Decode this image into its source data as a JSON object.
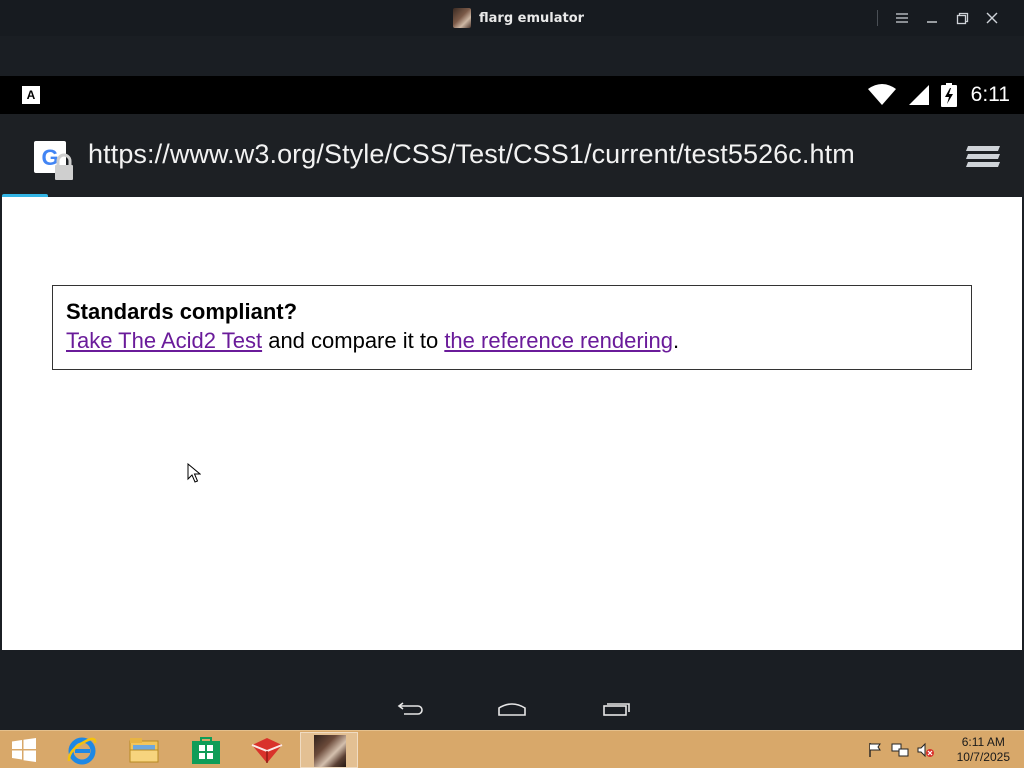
{
  "window": {
    "title": "flarg emulator"
  },
  "status_bar": {
    "time": "6:11",
    "left_icon_letter": "A"
  },
  "browser": {
    "url": "https://www.w3.org/Style/CSS/Test/CSS1/current/test5526c.htm",
    "load_progress": 0.045
  },
  "page": {
    "heading": "Standards compliant?",
    "link1": "Take The Acid2 Test",
    "middle_text": " and compare it to ",
    "link2": "the reference rendering",
    "end_text": "."
  },
  "taskbar": {
    "clock_time": "6:11 AM",
    "clock_date": "10/7/2025"
  },
  "colors": {
    "link": "#6a1b9a",
    "progress": "#33b5e5",
    "taskbar": "#d8a86a"
  }
}
